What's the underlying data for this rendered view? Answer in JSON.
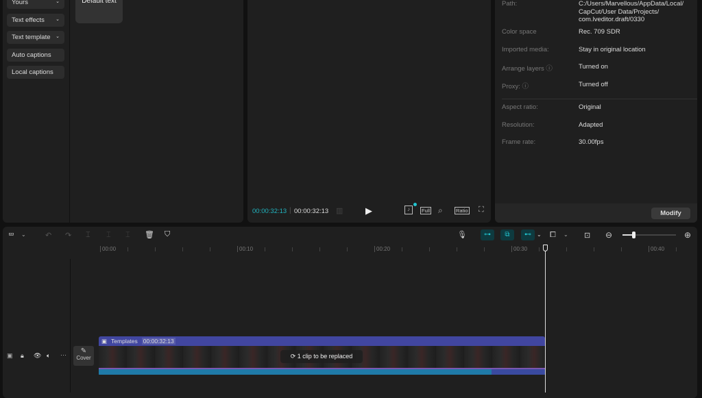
{
  "left_menu": [
    {
      "label": "Yours",
      "dropdown": true
    },
    {
      "label": "Text effects",
      "dropdown": true
    },
    {
      "label": "Text template",
      "dropdown": true
    },
    {
      "label": "Auto captions",
      "dropdown": false
    },
    {
      "label": "Local captions",
      "dropdown": false
    }
  ],
  "text_tile": {
    "label": "Default text"
  },
  "player": {
    "current_time": "00:00:32:13",
    "total_time": "00:00:32:13",
    "full_label": "Full",
    "ratio_label": "Ratio"
  },
  "details": {
    "path_label": "Path:",
    "path_value": "C:/Users/Marvellous/AppData/Local/ CapCut/User Data/Projects/ com.lveditor.draft/0330",
    "rows": [
      {
        "k": "Color space",
        "v": "Rec. 709 SDR"
      },
      {
        "k": "Imported media:",
        "v": "Stay in original location"
      },
      {
        "k": "Arrange layers ⓘ",
        "v": "Turned on"
      },
      {
        "k": "Proxy: ⓘ",
        "v": "Turned off"
      }
    ],
    "rows2": [
      {
        "k": "Aspect ratio:",
        "v": "Original"
      },
      {
        "k": "Resolution:",
        "v": "Adapted"
      },
      {
        "k": "Frame rate:",
        "v": "30.00fps"
      }
    ],
    "modify_label": "Modify"
  },
  "timeline": {
    "ruler": [
      "00:00",
      "00:10",
      "00:20",
      "00:30",
      "00:40"
    ],
    "cover_label": "Cover",
    "clip": {
      "name": "Templates",
      "duration": "00:00:32:13",
      "replace_notice": "1 clip to be replaced"
    },
    "zoom_level": 0.2,
    "accent": "#21c4cf",
    "clip_color": "#4146a0"
  }
}
